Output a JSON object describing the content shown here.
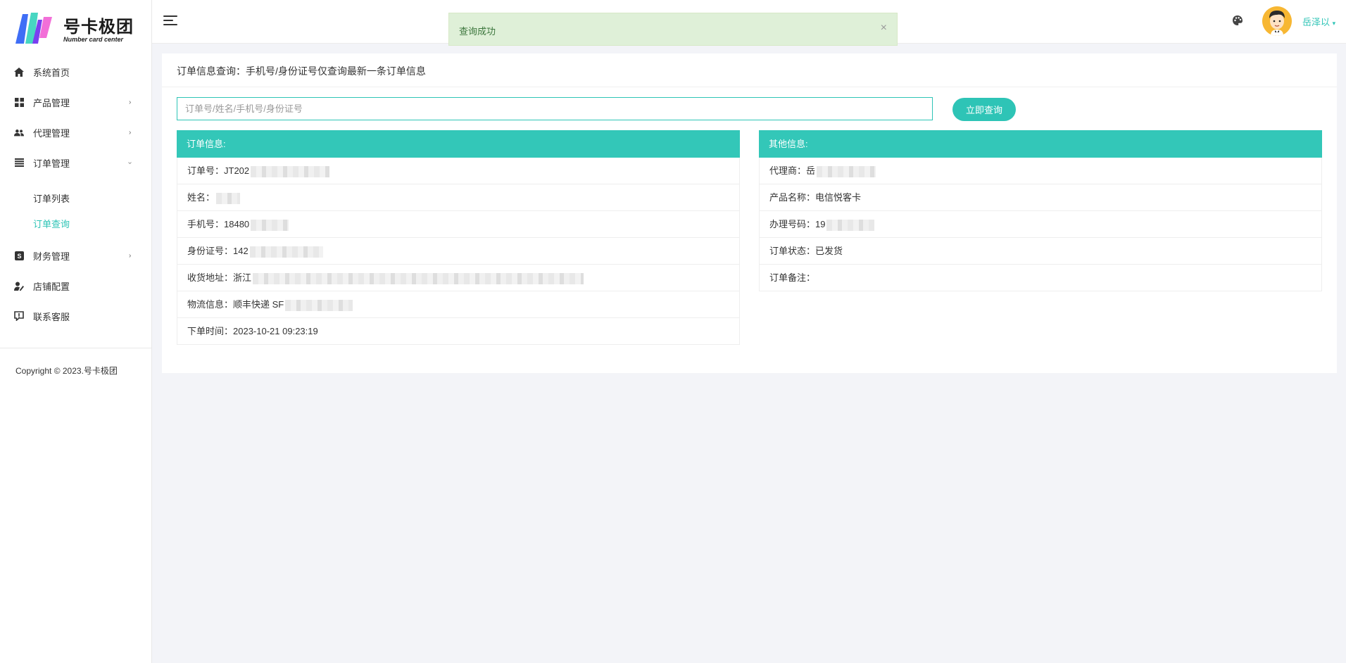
{
  "brand": {
    "title": "号卡极团",
    "subtitle": "Number card center",
    "colors": {
      "accent": "#2ec4b6",
      "logo_blue": "#3f6ef6",
      "logo_purple": "#7a3ff0",
      "logo_pink": "#f26fd8",
      "logo_teal": "#47d6c2"
    }
  },
  "sidebar": {
    "items": [
      {
        "label": "系统首页",
        "icon": "home-icon",
        "has_children": false
      },
      {
        "label": "产品管理",
        "icon": "grid-icon",
        "has_children": true,
        "expanded": false
      },
      {
        "label": "代理管理",
        "icon": "users-icon",
        "has_children": true,
        "expanded": false
      },
      {
        "label": "订单管理",
        "icon": "list-icon",
        "has_children": true,
        "expanded": true
      },
      {
        "label": "财务管理",
        "icon": "finance-icon",
        "has_children": true,
        "expanded": false
      },
      {
        "label": "店铺配置",
        "icon": "store-config-icon",
        "has_children": false
      },
      {
        "label": "联系客服",
        "icon": "support-icon",
        "has_children": false
      }
    ],
    "order_children": [
      {
        "label": "订单列表",
        "active": false
      },
      {
        "label": "订单查询",
        "active": true
      }
    ],
    "copyright": "Copyright © 2023.号卡极团"
  },
  "header": {
    "toast": {
      "text": "查询成功",
      "close": "×"
    },
    "user_name": "岳泽以",
    "user_caret": "▾"
  },
  "main": {
    "title": "订单信息查询：手机号/身份证号仅查询最新一条订单信息",
    "search": {
      "placeholder": "订单号/姓名/手机号/身份证号",
      "value": ""
    },
    "search_button": "立即查询",
    "order_panel": {
      "title": "订单信息:",
      "rows": [
        {
          "label": "订单号：",
          "value": "JT202"
        },
        {
          "label": "姓名：",
          "value": ""
        },
        {
          "label": "手机号：",
          "value": "18480"
        },
        {
          "label": "身份证号：",
          "value": "142"
        },
        {
          "label": "收货地址：",
          "value": "浙江"
        },
        {
          "label": "物流信息：",
          "value": "顺丰快递 SF"
        },
        {
          "label": "下单时间：",
          "value": "2023-10-21 09:23:19"
        }
      ]
    },
    "other_panel": {
      "title": "其他信息:",
      "rows": [
        {
          "label": "代理商：",
          "value": "岳"
        },
        {
          "label": "产品名称：",
          "value": "电信悦客卡"
        },
        {
          "label": "办理号码：",
          "value": "19"
        },
        {
          "label": "订单状态：",
          "value": "已发货"
        },
        {
          "label": "订单备注：",
          "value": ""
        }
      ]
    }
  }
}
